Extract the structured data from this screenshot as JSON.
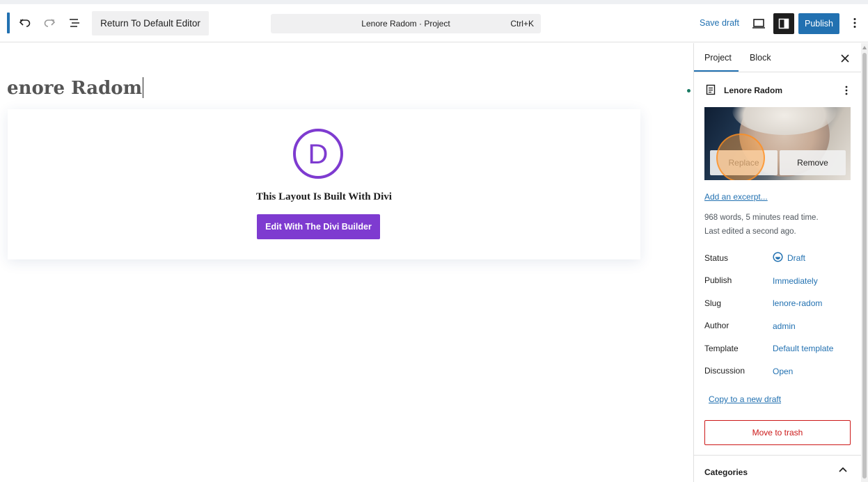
{
  "header": {
    "return_label": "Return To Default Editor",
    "command_title": "Lenore Radom · Project",
    "command_shortcut": "Ctrl+K",
    "save_draft_label": "Save draft",
    "publish_label": "Publish"
  },
  "editor": {
    "post_title": "enore Radom",
    "divi": {
      "logo_letter": "D",
      "heading": "This Layout Is Built With Divi",
      "button_label": "Edit With The Divi Builder"
    }
  },
  "sidebar": {
    "tabs": [
      {
        "label": "Project",
        "active": true
      },
      {
        "label": "Block",
        "active": false
      }
    ],
    "document_title": "Lenore Radom",
    "featured_image": {
      "replace_label": "Replace",
      "remove_label": "Remove"
    },
    "excerpt_link": "Add an excerpt...",
    "word_count": "968 words, 5 minutes read time.",
    "last_edited": "Last edited a second ago.",
    "rows": [
      {
        "label": "Status",
        "value": "Draft"
      },
      {
        "label": "Publish",
        "value": "Immediately"
      },
      {
        "label": "Slug",
        "value": "lenore-radom"
      },
      {
        "label": "Author",
        "value": "admin"
      },
      {
        "label": "Template",
        "value": "Default template"
      },
      {
        "label": "Discussion",
        "value": "Open"
      }
    ],
    "copy_link": "Copy to a new draft",
    "trash_label": "Move to trash",
    "categories_label": "Categories"
  },
  "colors": {
    "accent": "#2271b1",
    "divi_purple": "#7e3bd0",
    "danger": "#cc1818"
  },
  "icons": [
    "undo-icon",
    "redo-icon",
    "document-overview-icon",
    "preview-device-icon",
    "sidebar-toggle-icon",
    "more-options-icon",
    "close-icon",
    "post-document-icon",
    "draft-status-icon",
    "chevron-up-icon"
  ]
}
